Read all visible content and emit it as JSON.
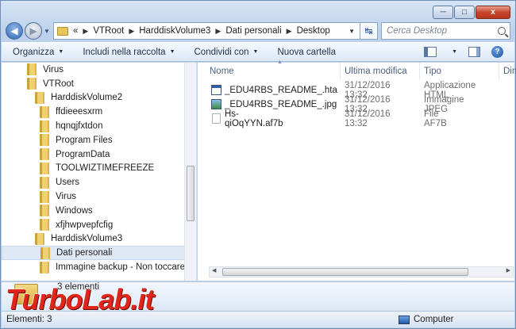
{
  "window": {
    "caption_minimize": "─",
    "caption_maximize": "□",
    "caption_close": "x"
  },
  "address": {
    "overflow": "«",
    "crumbs": [
      "VTRoot",
      "HarddiskVolume3",
      "Dati personali",
      "Desktop"
    ],
    "refresh_glyph": "↹"
  },
  "search": {
    "placeholder": "Cerca Desktop"
  },
  "toolbar": {
    "organize": "Organizza",
    "include": "Includi nella raccolta",
    "share": "Condividi con",
    "new_folder": "Nuova cartella",
    "help": "?"
  },
  "tree": [
    {
      "label": "Virus",
      "indent": 1
    },
    {
      "label": "VTRoot",
      "indent": 1
    },
    {
      "label": "HarddiskVolume2",
      "indent": 2
    },
    {
      "label": "ffdieeesxrm",
      "indent": 3
    },
    {
      "label": "hqnqjfxtdon",
      "indent": 3
    },
    {
      "label": "Program Files",
      "indent": 3
    },
    {
      "label": "ProgramData",
      "indent": 3
    },
    {
      "label": "TOOLWIZTIMEFREEZE",
      "indent": 3
    },
    {
      "label": "Users",
      "indent": 3
    },
    {
      "label": "Virus",
      "indent": 3
    },
    {
      "label": "Windows",
      "indent": 3
    },
    {
      "label": "xfjhwpvepfcfig",
      "indent": 3
    },
    {
      "label": "HarddiskVolume3",
      "indent": 2
    },
    {
      "label": "Dati personali",
      "indent": 3,
      "selected": true
    },
    {
      "label": "Immagine backup - Non toccare",
      "indent": 3
    }
  ],
  "columns": {
    "name": "Nome",
    "modified": "Ultima modifica",
    "type": "Tipo",
    "size": "Dim"
  },
  "files": [
    {
      "name": "_EDU4RBS_README_.hta",
      "date": "31/12/2016 13:32",
      "type": "Applicazione HTML",
      "icon": "hta-file-icon"
    },
    {
      "name": "_EDU4RBS_README_.jpg",
      "date": "31/12/2016 13:32",
      "type": "Immagine JPEG",
      "icon": "jpeg-file-icon"
    },
    {
      "name": "Hs-qiOqYYN.af7b",
      "date": "31/12/2016 13:32",
      "type": "File AF7B",
      "icon": "generic-file-icon"
    }
  ],
  "details": {
    "count": "3 elementi"
  },
  "status": {
    "left": "Elementi: 3",
    "right": "Computer"
  },
  "watermark": {
    "text": "TurboLab.it"
  }
}
